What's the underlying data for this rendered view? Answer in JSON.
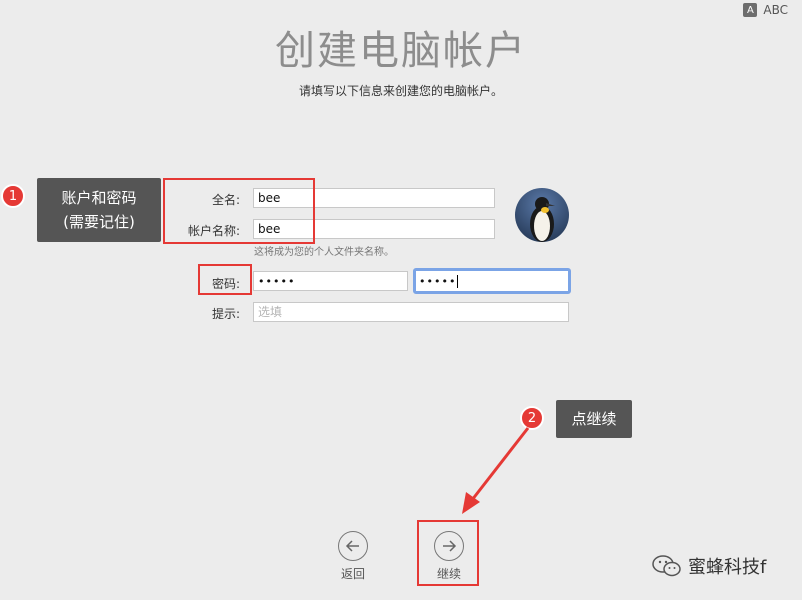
{
  "header": {
    "title": "创建电脑帐户",
    "subtitle": "请填写以下信息来创建您的电脑帐户。"
  },
  "keyboard_indicator": {
    "icon_letter": "A",
    "label": "ABC"
  },
  "form": {
    "full_name_label": "全名:",
    "full_name_value": "bee",
    "account_name_label": "帐户名称:",
    "account_name_value": "bee",
    "account_help": "这将成为您的个人文件夹名称。",
    "password_label": "密码:",
    "password_value": "•••••",
    "verify_value": "•••••",
    "hint_label": "提示:",
    "hint_placeholder": "选填"
  },
  "annotations": {
    "badge1": "1",
    "callout1_line1": "账户和密码",
    "callout1_line2": "(需要记住)",
    "badge2": "2",
    "callout2": "点继续"
  },
  "nav": {
    "back_label": "返回",
    "continue_label": "继续"
  },
  "watermark": {
    "text": "蜜蜂科技f"
  },
  "colors": {
    "accent_red": "#e53935",
    "callout_bg": "#555555",
    "focus_ring": "#7ba4e6"
  }
}
